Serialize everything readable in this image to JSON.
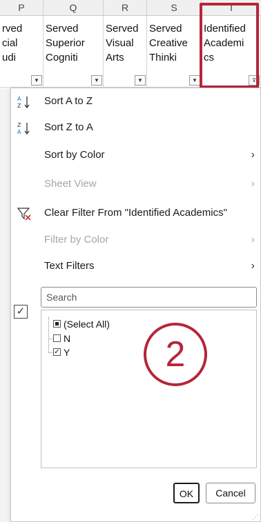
{
  "columns": [
    "P",
    "Q",
    "R",
    "S",
    "T"
  ],
  "cells": [
    {
      "lines": [
        "rved",
        "cial",
        "udi"
      ]
    },
    {
      "lines": [
        "Served",
        "Superior",
        "Cogniti"
      ]
    },
    {
      "lines": [
        "Served",
        "Visual",
        "Arts"
      ]
    },
    {
      "lines": [
        "Served",
        "Creative",
        "Thinki"
      ]
    },
    {
      "lines": [
        "Identified",
        "Academi",
        "cs"
      ]
    }
  ],
  "menu": {
    "sort_az": "Sort A to Z",
    "sort_za": "Sort Z to A",
    "sort_color": "Sort by Color",
    "sheet_view": "Sheet View",
    "clear_filter": "Clear Filter From \"Identified Academics\"",
    "filter_color": "Filter by Color",
    "text_filters": "Text Filters",
    "search_placeholder": "Search",
    "items": [
      "(Select All)",
      "N",
      "Y"
    ],
    "ok": "OK",
    "cancel": "Cancel"
  },
  "annotation": "2",
  "icons": {
    "submenu": "chevron-right-icon",
    "check": "check-icon"
  },
  "colors": {
    "accent": "#b5253a"
  }
}
